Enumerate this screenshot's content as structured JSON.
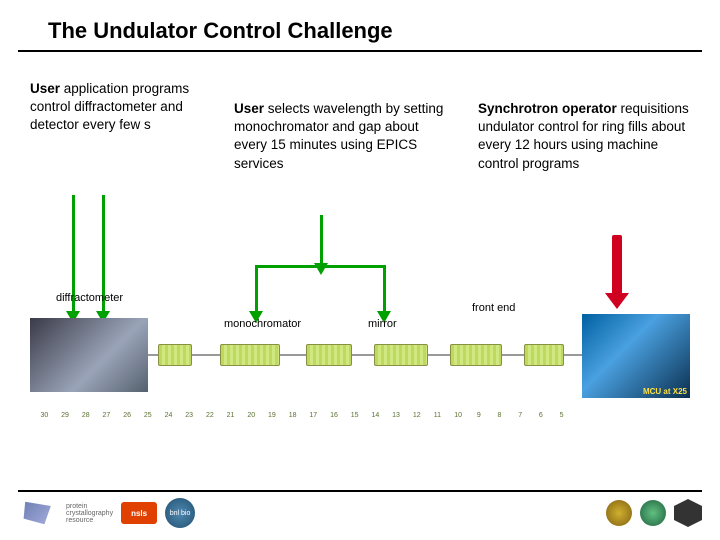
{
  "title": "The Undulator Control Challenge",
  "column1": {
    "bold": "User",
    "rest": " application programs control diffractometer and detector every few s"
  },
  "column2": {
    "bold": "User",
    "rest": " selects wavelength by setting monochromator and gap about every 15 minutes using EPICS services"
  },
  "column3": {
    "bold": "Synchrotron operator",
    "rest": " requisitions undulator control for ring fills about every 12 hours using machine control programs"
  },
  "labels": {
    "diffractometer": "diffractometer",
    "monochromator": "monochromator",
    "mirror": "mirror",
    "front_end": "front end"
  },
  "photo_right_caption": "MCU at X25",
  "scale_ticks": [
    "30",
    "29",
    "28",
    "27",
    "26",
    "25",
    "24",
    "23",
    "22",
    "21",
    "20",
    "19",
    "18",
    "17",
    "16",
    "15",
    "14",
    "13",
    "12",
    "11",
    "10",
    "9",
    "8",
    "7",
    "6",
    "5"
  ],
  "footer_text": {
    "pxrr_line1": "protein",
    "pxrr_line2": "crystallography",
    "pxrr_line3": "resource",
    "nsls": "nsls",
    "bnl": "bnl bio"
  }
}
